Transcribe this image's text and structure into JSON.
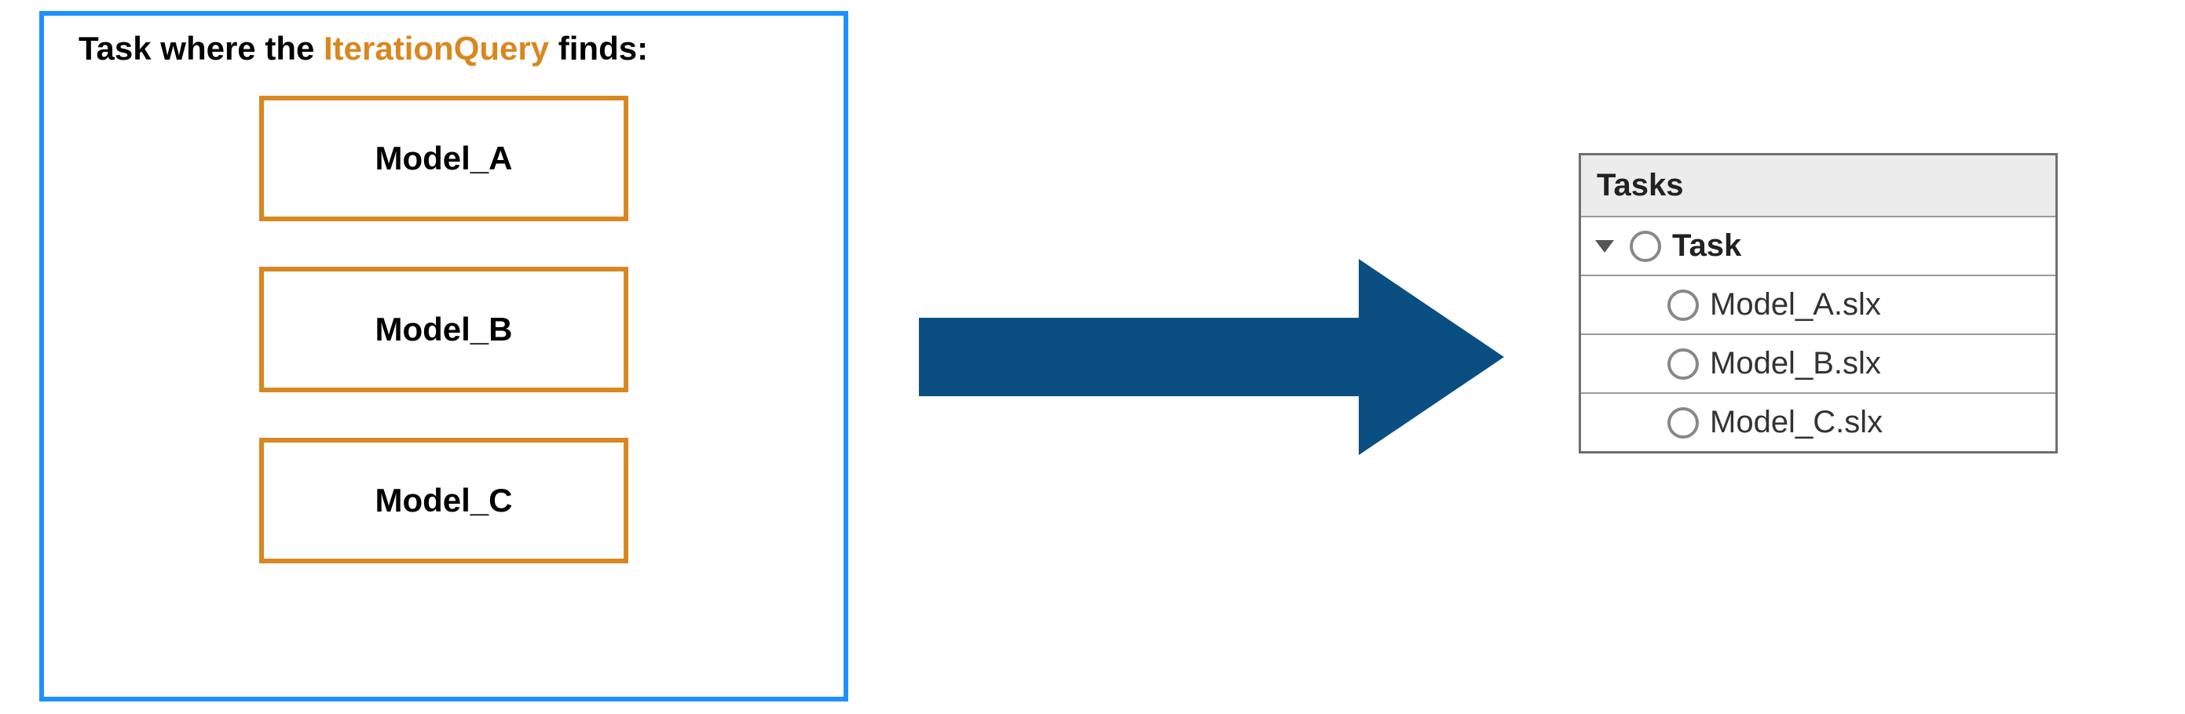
{
  "left": {
    "title_prefix": "Task where the ",
    "title_highlight": "IterationQuery",
    "title_suffix": " finds:",
    "models": [
      "Model_A",
      "Model_B",
      "Model_C"
    ]
  },
  "arrow": {
    "color": "#0b4f82"
  },
  "tasks_panel": {
    "header": "Tasks",
    "parent_label": "Task",
    "items": [
      "Model_A.slx",
      "Model_B.slx",
      "Model_C.slx"
    ]
  }
}
